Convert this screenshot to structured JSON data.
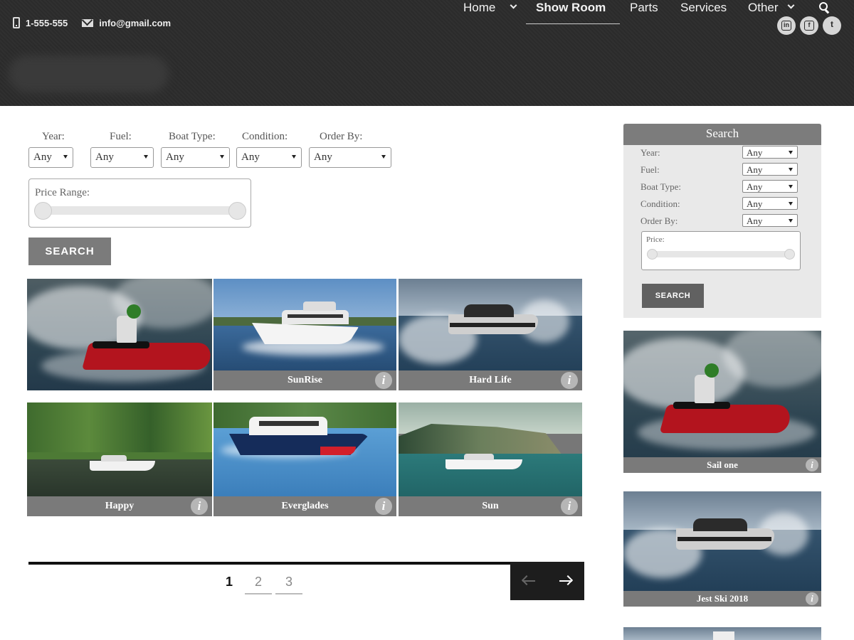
{
  "contact": {
    "phone": "1-555-555",
    "email": "info@gmail.com"
  },
  "social": [
    {
      "icon": "linkedin-icon",
      "glyph": "in"
    },
    {
      "icon": "facebook-icon",
      "glyph": "f"
    },
    {
      "icon": "twitter-icon",
      "glyph": "t"
    }
  ],
  "nav": {
    "items": [
      {
        "label": "Home",
        "has_dropdown": true
      },
      {
        "label": "Show Room",
        "active": true
      },
      {
        "label": "Parts"
      },
      {
        "label": "Services"
      },
      {
        "label": "Other",
        "has_dropdown": true
      }
    ],
    "search_icon": "search-icon"
  },
  "filters": {
    "year": {
      "label": "Year:",
      "value": "Any"
    },
    "fuel": {
      "label": "Fuel:",
      "value": "Any"
    },
    "boat_type": {
      "label": "Boat Type:",
      "value": "Any"
    },
    "condition": {
      "label": "Condition:",
      "value": "Any"
    },
    "order_by": {
      "label": "Order By:",
      "value": "Any"
    },
    "price_range_label": "Price Range:",
    "search_button": "SEARCH"
  },
  "boats": [
    {
      "name": "",
      "scene": "jetski"
    },
    {
      "name": "SunRise",
      "scene": "yacht"
    },
    {
      "name": "Hard Life",
      "scene": "speedboat"
    },
    {
      "name": "Happy",
      "scene": "river"
    },
    {
      "name": "Everglades",
      "scene": "cruiser"
    },
    {
      "name": "Sun",
      "scene": "bay"
    }
  ],
  "info_glyph": "i",
  "pagination": {
    "pages": [
      "1",
      "2",
      "3"
    ],
    "current": "1"
  },
  "sidebar": {
    "title": "Search",
    "fields": [
      {
        "label": "Year:",
        "value": "Any"
      },
      {
        "label": "Fuel:",
        "value": "Any"
      },
      {
        "label": "Boat Type:",
        "value": "Any"
      },
      {
        "label": "Condition:",
        "value": "Any"
      },
      {
        "label": "Order By:",
        "value": "Any"
      }
    ],
    "price_label": "Price:",
    "search_button": "SEARCH",
    "featured": [
      {
        "name": "Sail one",
        "scene": "jetski"
      },
      {
        "name": "Jest Ski 2018",
        "scene": "speedboat"
      }
    ]
  },
  "colors": {
    "header_bg": "#2b2b2b",
    "caption_bg": "#7a7a7a",
    "button_bg": "#7b7b7b",
    "pager_bg": "#1d1d1d"
  }
}
